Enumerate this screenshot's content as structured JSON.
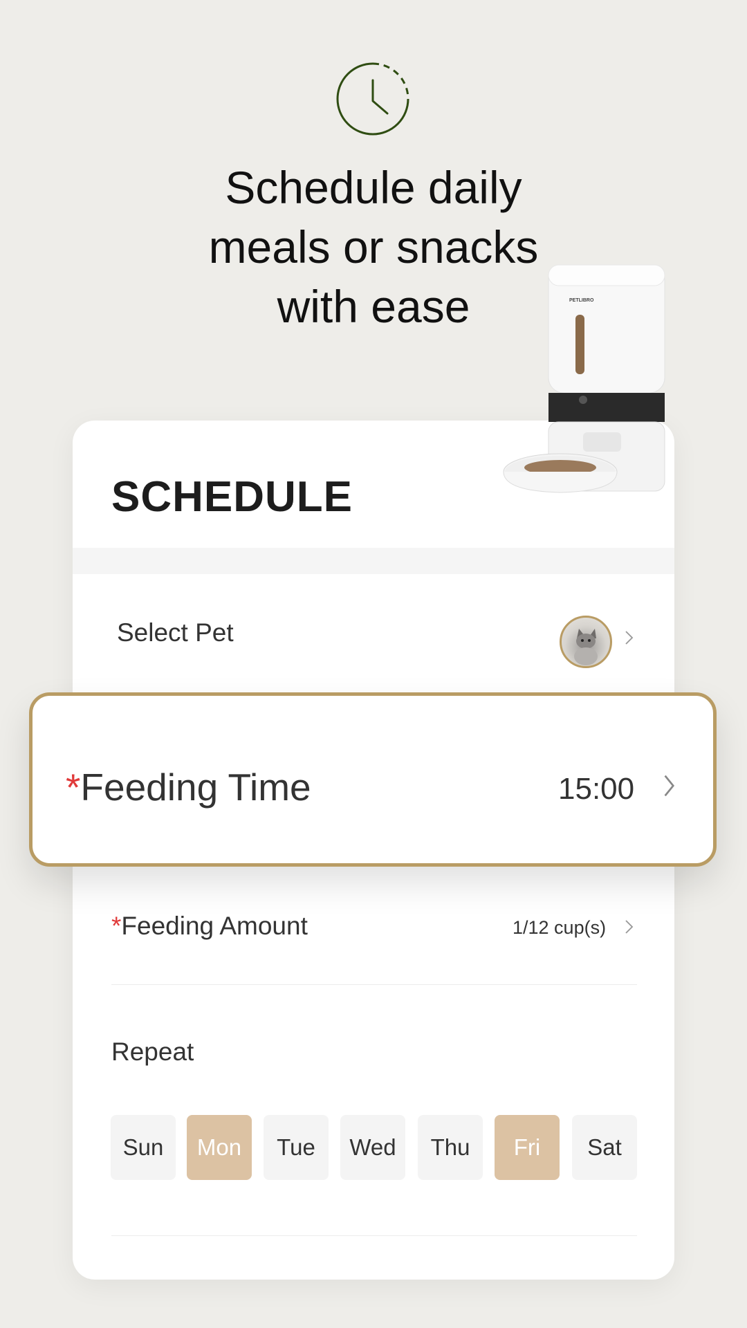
{
  "headline": {
    "line1": "Schedule daily",
    "line2": "meals or snacks",
    "line3": "with ease"
  },
  "feeder": {
    "brand": "PETLIBRO"
  },
  "schedule": {
    "title": "SCHEDULE",
    "select_pet": {
      "label": "Select Pet"
    },
    "feeding_time": {
      "required_mark": "*",
      "label": "Feeding Time",
      "value": "15:00"
    },
    "feeding_amount": {
      "required_mark": "*",
      "label": "Feeding Amount",
      "value": "1/12 cup(s)"
    },
    "repeat": {
      "label": "Repeat",
      "days": [
        {
          "label": "Sun",
          "selected": false
        },
        {
          "label": "Mon",
          "selected": true
        },
        {
          "label": "Tue",
          "selected": false
        },
        {
          "label": "Wed",
          "selected": false
        },
        {
          "label": "Thu",
          "selected": false
        },
        {
          "label": "Fri",
          "selected": true
        },
        {
          "label": "Sat",
          "selected": false
        }
      ]
    }
  },
  "colors": {
    "background": "#eeede9",
    "accent_gold": "#b99c64",
    "selected_day": "#dcc2a3",
    "required": "#e03a3a",
    "clock_icon": "#2f4d12"
  },
  "icons": {
    "header": "clock-icon",
    "row_arrow": "chevron-right-icon",
    "pet_avatar": "cat-avatar"
  }
}
